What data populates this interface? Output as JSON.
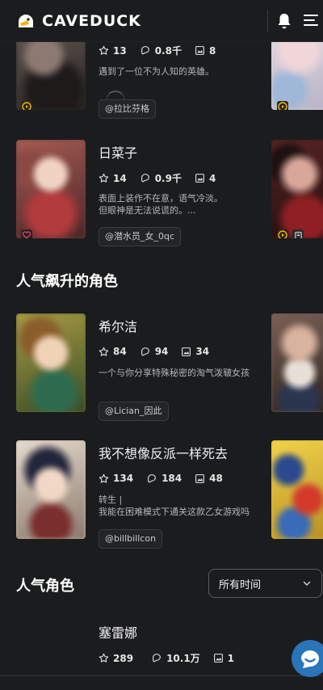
{
  "app": {
    "brand": "CAVEDUCK"
  },
  "header": {
    "logo_icon": "duck-icon",
    "bell_icon": "bell-icon",
    "menu_icon": "hamburger-menu-icon"
  },
  "sections": {
    "rising_title": "人气飙升的角色",
    "popular_title": "人气角色",
    "time_filter": "所有时间"
  },
  "cards": [
    {
      "name": "",
      "likes": "13",
      "chats": "0.8千",
      "images": "8",
      "desc1": "遇到了一位不为人知的英雄。",
      "desc2": "",
      "author": "@拉比芬格"
    },
    {
      "name": "日菜子",
      "likes": "14",
      "chats": "0.9千",
      "images": "4",
      "desc1": "表面上装作不在意，语气冷淡。",
      "desc2": "但眼神是无法说谎的。...",
      "author": "@潜水员_女_0qc"
    },
    {
      "name": "希尔洁",
      "likes": "84",
      "chats": "94",
      "images": "34",
      "desc1": "一个与你分享特殊秘密的淘气泼皲女孩",
      "desc2": "",
      "author": "@Lician_因此"
    },
    {
      "name": "我不想像反派一样死去",
      "likes": "134",
      "chats": "184",
      "images": "48",
      "desc1": "转生 |",
      "desc2": "我能在困难模式下通关这款乙女游戏吗",
      "author": "@billbillcon"
    },
    {
      "name": "塞雷娜",
      "likes": "289",
      "chats": "10.1万",
      "images": "1",
      "desc1": "",
      "desc2": "",
      "author": ""
    }
  ],
  "colors": {
    "background": "#1b1c1e",
    "accent": "#f5b400",
    "heart": "#e74c6f",
    "fab": "#2a74b8"
  }
}
